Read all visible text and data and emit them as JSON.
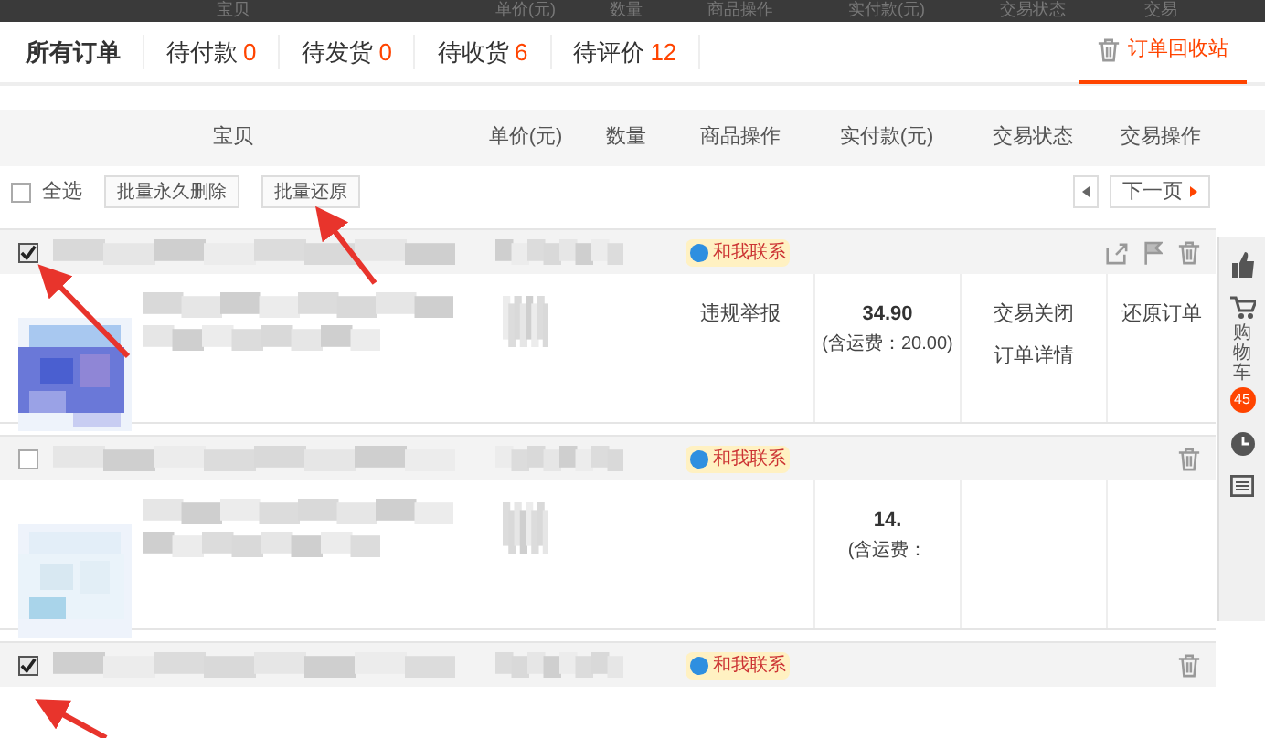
{
  "sticky_header": {
    "columns": [
      "宝贝",
      "单价(元)",
      "数量",
      "商品操作",
      "实付款(元)",
      "交易状态",
      "交易"
    ]
  },
  "tabs": [
    {
      "label": "所有订单",
      "selected": false
    },
    {
      "label": "待付款",
      "count": "0",
      "selected": false
    },
    {
      "label": "待发货",
      "count": "0",
      "selected": false
    },
    {
      "label": "待收货",
      "count": "6",
      "selected": false
    },
    {
      "label": "待评价",
      "count": "12",
      "selected": false
    }
  ],
  "recycle_tab": {
    "label": "订单回收站",
    "selected": true
  },
  "table_header": {
    "columns": [
      "宝贝",
      "单价(元)",
      "数量",
      "商品操作",
      "实付款(元)",
      "交易状态",
      "交易操作"
    ]
  },
  "toolbar": {
    "select_all": {
      "label": "全选",
      "checked": false
    },
    "buttons": [
      "批量永久删除",
      "批量还原"
    ],
    "next_page": "下一页"
  },
  "orders": [
    {
      "checked": true,
      "contact": "和我联系",
      "kind": "full",
      "item": {
        "product_action": "违规举报",
        "price": "34.90",
        "shipping": "(含运费：20.00)",
        "status": "交易关闭",
        "detail": "订单详情",
        "action": "还原订单"
      }
    },
    {
      "checked": false,
      "contact": "和我联系",
      "kind": "trash_only",
      "item": {
        "price": "14.",
        "shipping": "(含运费："
      }
    },
    {
      "checked": true,
      "contact": "和我联系",
      "kind": "trash_only"
    }
  ],
  "sidebar": {
    "cart_label": "购物车",
    "cart_count": "45"
  }
}
